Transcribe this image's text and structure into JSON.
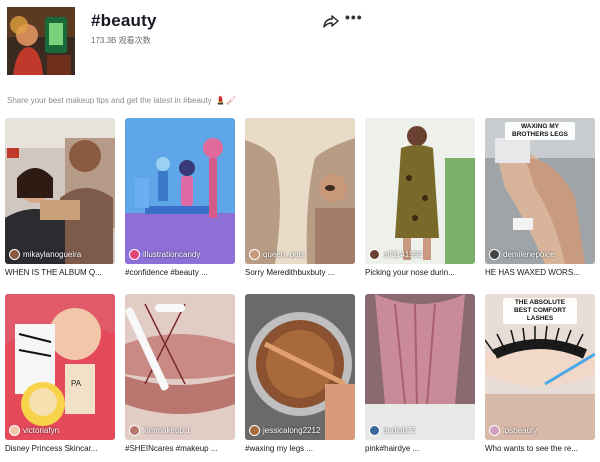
{
  "header": {
    "title": "#beauty",
    "views": "173.3B 观看次数",
    "share_icon": "share-icon",
    "more_icon": "more-horizontal-icon"
  },
  "description": {
    "text": "Share your best makeup tips and get the latest in #beauty",
    "emoji": "💄🖌"
  },
  "videos": [
    {
      "author": "mikaylanogueira",
      "caption": "WHEN IS THE ALBUM Q...",
      "verified": true
    },
    {
      "author": "illustrationcandy",
      "caption": "#confidence #beauty ...",
      "verified": false
    },
    {
      "author": "queen_peul",
      "caption": "Sorry Meredithbuxbuty ...",
      "verified": false
    },
    {
      "author": "elf3141592",
      "caption": "Picking your nose durin...",
      "verified": false
    },
    {
      "author": "demilenepoice",
      "caption": "HE HAS WAXED WORS...",
      "verified": false,
      "overlay": "WAXING MY BROTHERS LEGS"
    },
    {
      "author": "victoriafyn",
      "caption": "Disney Princess Skincar...",
      "verified": true
    },
    {
      "author": "kimmakeup.1",
      "caption": "#SHEINcares #makeup ...",
      "verified": false
    },
    {
      "author": "jessicalong2212",
      "caption": "#waxing my legs ...",
      "verified": false
    },
    {
      "author": "badia073",
      "caption": "pink#hairdye ...",
      "verified": false
    },
    {
      "author": "ipsbeauty",
      "caption": "Who wants to see the re...",
      "verified": false,
      "overlay": "THE ABSOLUTE BEST COMFORT LASHES"
    }
  ],
  "colors": {
    "text_primary": "#161823",
    "text_secondary": "#8a8b91",
    "accent": "#fe2c55"
  }
}
